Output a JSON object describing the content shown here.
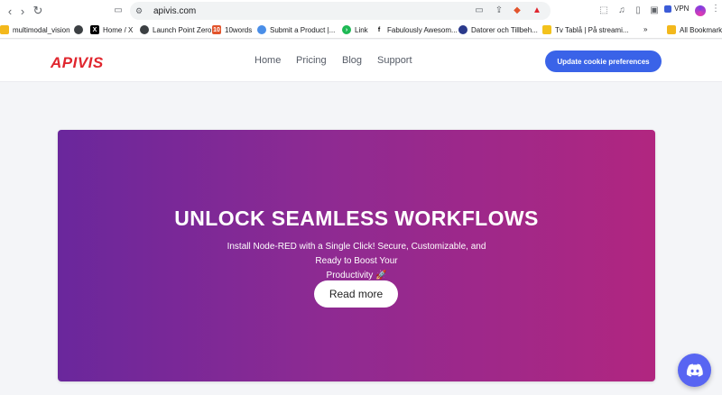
{
  "browser": {
    "url": "apivis.com",
    "vpn_label": "VPN",
    "bookmarks": [
      {
        "label": "multimodal_vision",
        "icon": "folder-icon"
      },
      {
        "label": "",
        "icon": "globe-icon"
      },
      {
        "label": "Home / X",
        "icon": "x-icon"
      },
      {
        "label": "Launch Point Zero",
        "icon": "globe-icon"
      },
      {
        "label": "10words",
        "icon": "10words-icon"
      },
      {
        "label": "Submit a Product |...",
        "icon": "cloud-icon"
      },
      {
        "label": "Link",
        "icon": "link-icon"
      },
      {
        "label": "Fabulously Awesom...",
        "icon": "f-icon"
      },
      {
        "label": "Datorer och Tillbeh...",
        "icon": "store-icon"
      },
      {
        "label": "Tv Tablå | På streami...",
        "icon": "tv-icon"
      }
    ],
    "all_bookmarks_label": "All Bookmarks",
    "overflow_label": "»"
  },
  "site": {
    "logo": "APIVIS",
    "nav": [
      "Home",
      "Pricing",
      "Blog",
      "Support"
    ],
    "cookie_button": "Update cookie preferences"
  },
  "hero": {
    "title": "UNLOCK SEAMLESS WORKFLOWS",
    "subtitle_line1": "Install Node-RED with a Single Click! Secure, Customizable, and Ready to Boost Your",
    "subtitle_line2": "Productivity 🚀",
    "cta": "Read more"
  },
  "colors": {
    "brand": "#e0262e",
    "cookie_button": "#3a63e8",
    "hero_gradient_start": "#6a279c",
    "hero_gradient_end": "#b12680",
    "discord": "#5865f2"
  }
}
